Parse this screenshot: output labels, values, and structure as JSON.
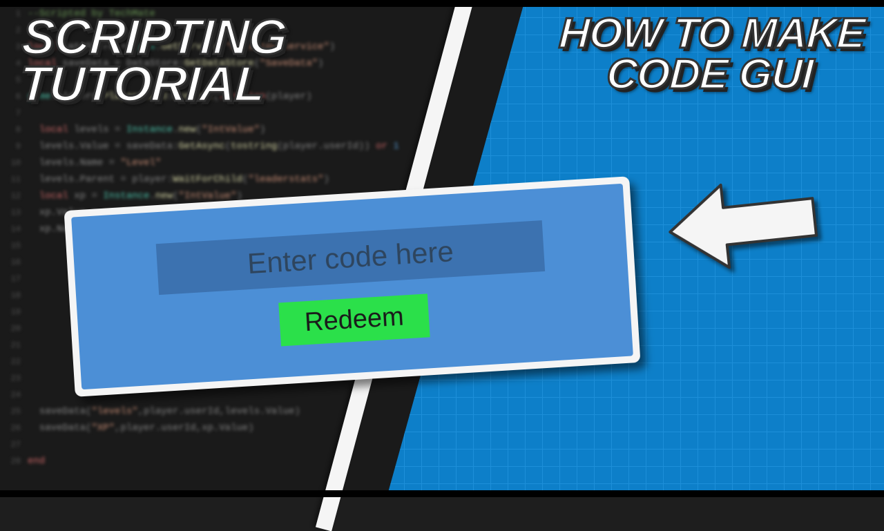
{
  "titles": {
    "left_line1": "SCRIPTING",
    "left_line2": "TUTORIAL",
    "right_line1": "HOW TO MAKE",
    "right_line2": "CODE GUI"
  },
  "panel": {
    "placeholder": "Enter code here",
    "button": "Redeem"
  }
}
